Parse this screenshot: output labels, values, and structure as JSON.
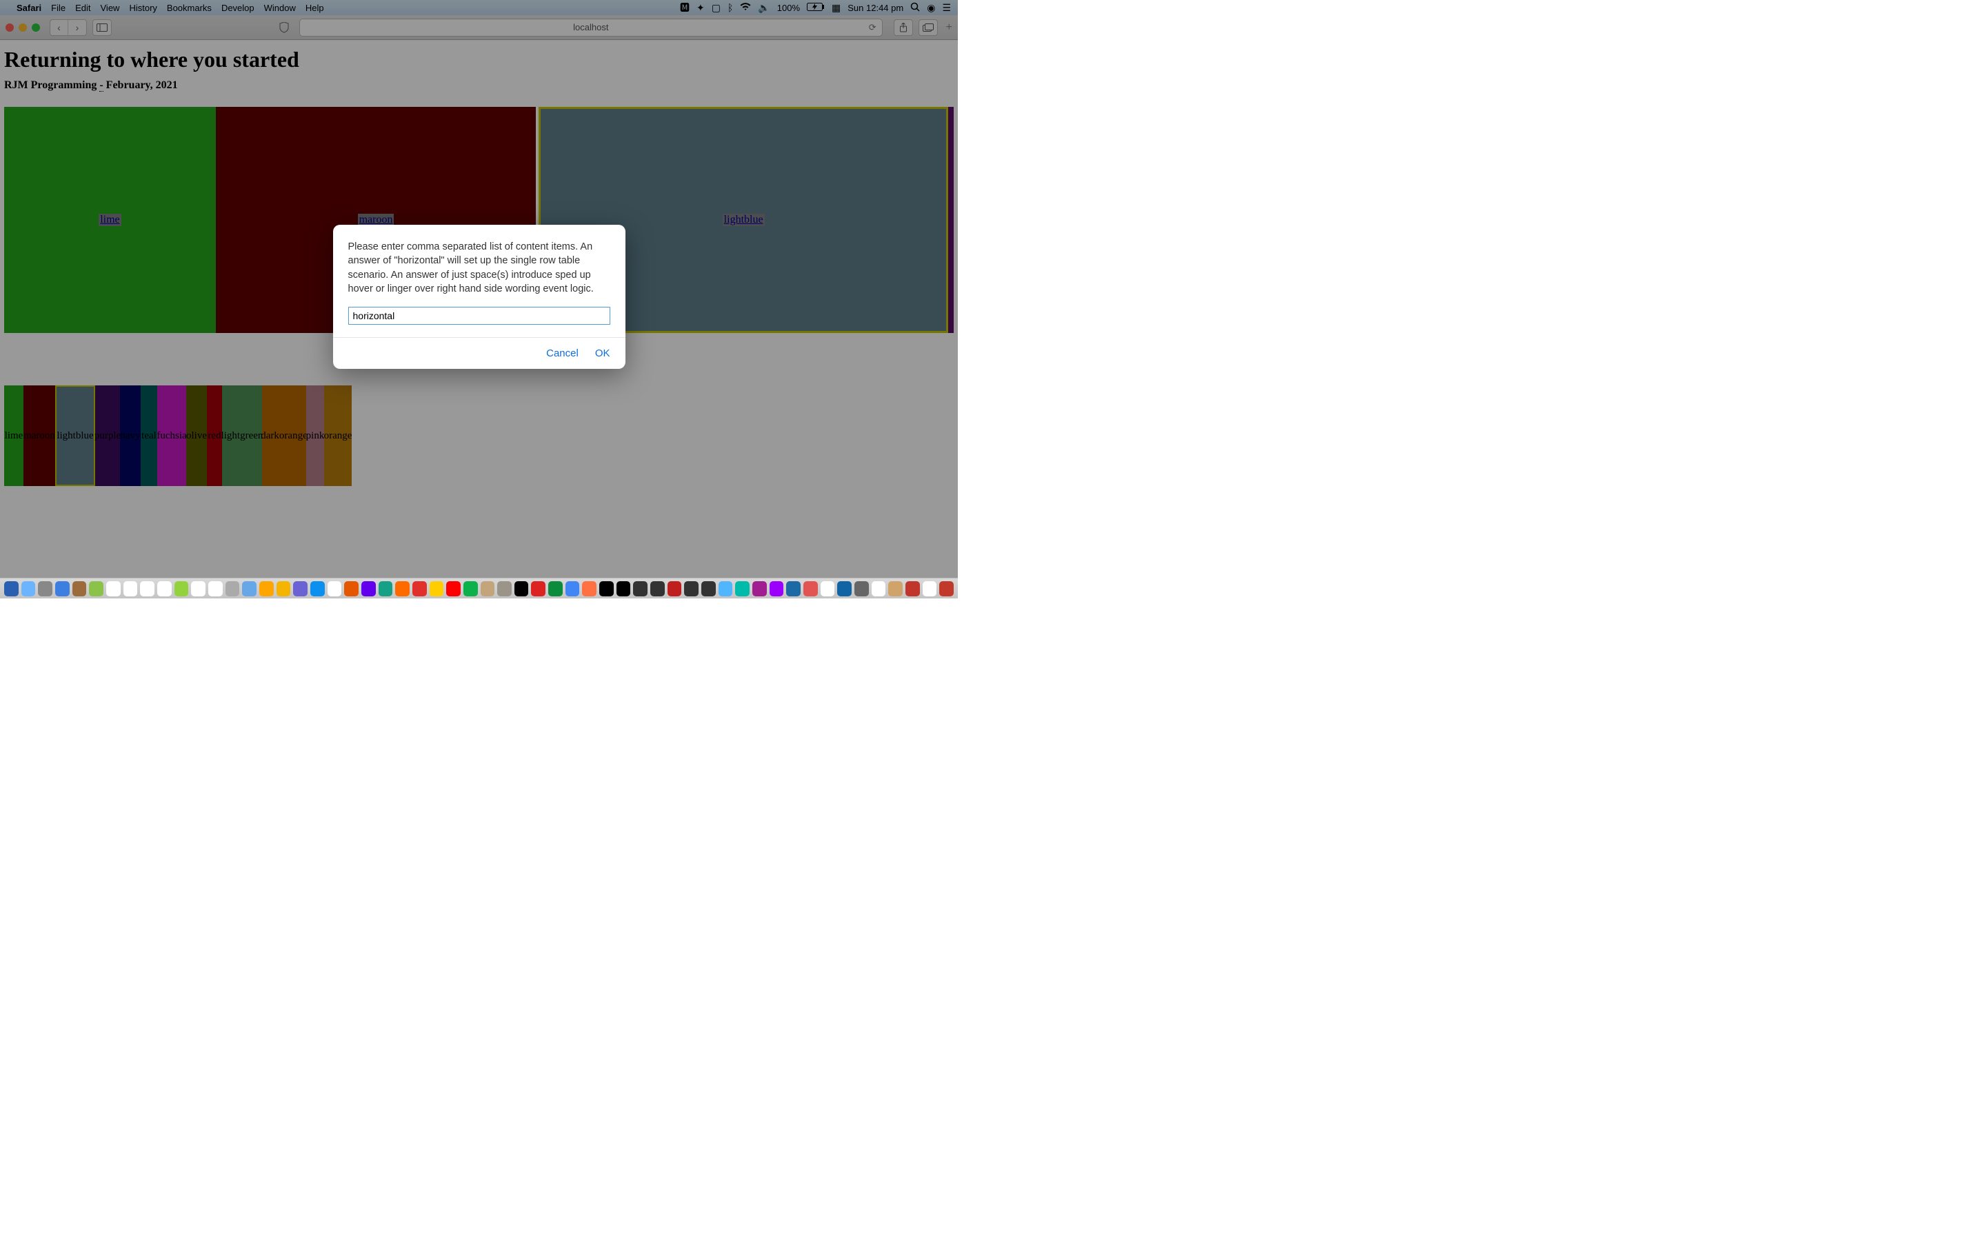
{
  "menubar": {
    "app": "Safari",
    "items": [
      "File",
      "Edit",
      "View",
      "History",
      "Bookmarks",
      "Develop",
      "Window",
      "Help"
    ],
    "battery": "100%",
    "clock": "Sun 12:44 pm"
  },
  "toolbar": {
    "address": "localhost"
  },
  "page": {
    "title": "Returning to where you started",
    "subtitle_before": "RJM Programming ",
    "subtitle_dash": "-",
    "subtitle_after": " February, 2021",
    "big_cells": [
      {
        "label": "lime",
        "bg": "#26a61c"
      },
      {
        "label": "maroon",
        "bg": "#620000"
      },
      {
        "label": "lightblue",
        "bg": "#5f7f8c"
      }
    ],
    "sliver": {
      "bg": "#5a0d6b"
    },
    "thumbs": [
      {
        "label": "lime",
        "bg": "#26a61c",
        "width": 28
      },
      {
        "label": "maroon",
        "bg": "#620000",
        "width": 46
      },
      {
        "label": "lightblue",
        "bg": "#5f7f8c",
        "width": 58,
        "border": "#c6c600"
      },
      {
        "label": "purple",
        "bg": "#3a0d5e",
        "width": 36
      },
      {
        "label": "navy",
        "bg": "#000565",
        "width": 30
      },
      {
        "label": "teal",
        "bg": "#005b5b",
        "width": 24
      },
      {
        "label": "fuchsia",
        "bg": "#c71ac7",
        "width": 42
      },
      {
        "label": "olive",
        "bg": "#5a5a00",
        "width": 30
      },
      {
        "label": "red",
        "bg": "#a6000a",
        "width": 22
      },
      {
        "label": "lightgreen",
        "bg": "#4e8f55",
        "width": 58
      },
      {
        "label": "darkorange",
        "bg": "#b76600",
        "width": 64
      },
      {
        "label": "pink",
        "bg": "#b47e8a",
        "width": 26
      },
      {
        "label": "orange",
        "bg": "#b87c0c",
        "width": 40
      }
    ]
  },
  "dialog": {
    "text": "Please enter comma separated list of content items.  An answer of \"horizontal\" will set up the single row table scenario.  An answer of just space(s) introduce sped up hover or linger over right hand side wording event logic.",
    "value": "horizontal",
    "cancel": "Cancel",
    "ok": "OK"
  },
  "dock_colors": [
    "#2b5faf",
    "#6db4ff",
    "#888",
    "#3d7fe0",
    "#9c6b3c",
    "#8bc34a",
    "#fff",
    "#fff",
    "#fff",
    "#fff",
    "#94d23d",
    "#fff",
    "#fff",
    "#aaa",
    "#67a7e8",
    "#ffa500",
    "#f4b400",
    "#6b63d4",
    "#0b90f0",
    "#fff",
    "#e45600",
    "#6200ee",
    "#16a085",
    "#ff6a00",
    "#e1302b",
    "#ffcd00",
    "#ff0000",
    "#0db14b",
    "#c4a57b",
    "#9b9488",
    "#000",
    "#d22",
    "#0b8b3c",
    "#4285f4",
    "#ff7043",
    "#000",
    "#000",
    "#333",
    "#333",
    "#c01f1f",
    "#333",
    "#333",
    "#52b6ff",
    "#0ba",
    "#a01e8f",
    "#9b00ff",
    "#1b6aa5",
    "#e25353",
    "#fff",
    "#1164a3",
    "#666",
    "#fff",
    "#d0a36b",
    "#c0362c",
    "#fff",
    "#c0392b"
  ]
}
